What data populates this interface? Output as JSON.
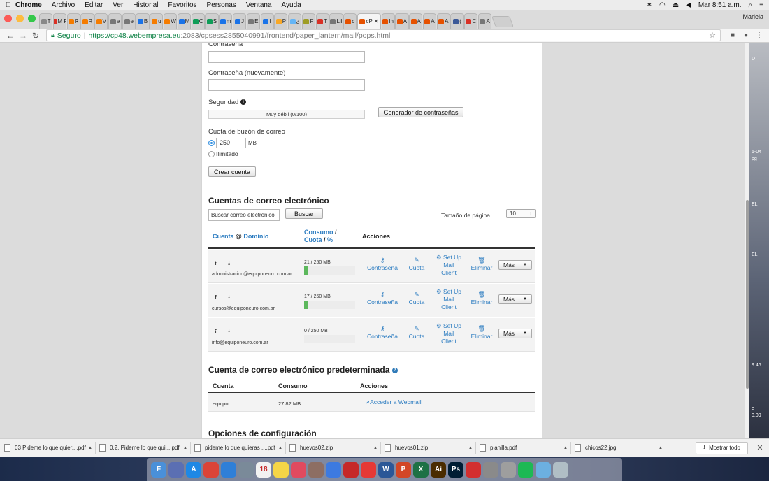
{
  "menubar": {
    "app": "Chrome",
    "items": [
      "Archivo",
      "Editar",
      "Ver",
      "Historial",
      "Favoritos",
      "Personas",
      "Ventana",
      "Ayuda"
    ],
    "clock": "Mar 8:51 a.m."
  },
  "tabs": [
    {
      "label": "T",
      "color": "#888"
    },
    {
      "label": "M R",
      "color": "#d93025"
    },
    {
      "label": "R",
      "color": "#f57c00"
    },
    {
      "label": "R",
      "color": "#f57c00"
    },
    {
      "label": "V",
      "color": "#f57c00"
    },
    {
      "label": "e",
      "color": "#777"
    },
    {
      "label": "e",
      "color": "#777"
    },
    {
      "label": "B",
      "color": "#1a73e8"
    },
    {
      "label": "u",
      "color": "#f57c00"
    },
    {
      "label": "W",
      "color": "#f57c00"
    },
    {
      "label": "M",
      "color": "#1a73e8"
    },
    {
      "label": "C",
      "color": "#0f9d58"
    },
    {
      "label": "S",
      "color": "#0f9d58"
    },
    {
      "label": "m",
      "color": "#1a73e8"
    },
    {
      "label": "J",
      "color": "#1a73e8"
    },
    {
      "label": "E",
      "color": "#777"
    },
    {
      "label": "I",
      "color": "#1a73e8"
    },
    {
      "label": "P",
      "color": "#f9a825"
    },
    {
      "label": "¿",
      "color": "#64b5f6"
    },
    {
      "label": "F",
      "color": "#9e9d24"
    },
    {
      "label": "T",
      "color": "#d93025"
    },
    {
      "label": "Lil",
      "color": "#777"
    },
    {
      "label": "c",
      "color": "#e65100"
    },
    {
      "label": "cP",
      "color": "#e65100",
      "active": true
    },
    {
      "label": "In",
      "color": "#e65100"
    },
    {
      "label": "A",
      "color": "#e65100"
    },
    {
      "label": "A",
      "color": "#e65100"
    },
    {
      "label": "A",
      "color": "#e65100"
    },
    {
      "label": "A",
      "color": "#e65100"
    },
    {
      "label": "(",
      "color": "#3b5998"
    },
    {
      "label": "C",
      "color": "#d93025"
    },
    {
      "label": "A",
      "color": "#777"
    }
  ],
  "profile": "Mariela",
  "address": {
    "secure_label": "Seguro",
    "host": "https://cp48.webempresa.eu",
    "path": ":2083/cpsess2855040991/frontend/paper_lantern/mail/pops.html"
  },
  "desktop": {
    "l1": "D",
    "l2": "5-04",
    "l3": "pg",
    "l4": "EL",
    "l5": "EL",
    "l6": "9.46",
    "l7": "e",
    "l8": "0.09"
  },
  "form": {
    "password_label": "Contraseña",
    "password_again_label": "Contraseña (nuevamente)",
    "security_label": "Seguridad",
    "strength_text": "Muy débil (0/100)",
    "generator_button": "Generador de contraseñas",
    "quota_label": "Cuota de buzón de correo",
    "quota_value": "250",
    "quota_unit": "MB",
    "unlimited_label": "Ilimitado",
    "create_button": "Crear cuenta"
  },
  "accounts": {
    "title": "Cuentas de correo electrónico",
    "search_placeholder": "Buscar correo electrónico",
    "search_button": "Buscar",
    "page_size_label": "Tamaño de página",
    "page_size_value": "10",
    "headers": {
      "account": "Cuenta",
      "at": "@",
      "domain": "Dominio",
      "usage": "Consumo",
      "slash": "/",
      "quota": "Cuota",
      "percent": "%",
      "actions": "Acciones"
    },
    "rows": [
      {
        "email": "administracion@equiponeuro.com.ar",
        "usage": "21 / 250 MB",
        "fraction": 0.084
      },
      {
        "email": "cursos@equiponeuro.com.ar",
        "usage": "17 / 250 MB",
        "fraction": 0.068
      },
      {
        "email": "info@equiponeuro.com.ar",
        "usage": "0 / 250 MB",
        "fraction": 0
      }
    ],
    "actions": {
      "password": "Contraseña",
      "quota": "Cuota",
      "setup_1": "Set Up",
      "setup_2": "Mail",
      "setup_3": "Client",
      "delete": "Eliminar",
      "more": "Más"
    }
  },
  "default_account": {
    "title": "Cuenta de correo electrónico predeterminada",
    "headers": {
      "account": "Cuenta",
      "usage": "Consumo",
      "actions": "Acciones"
    },
    "row": {
      "account": "equipo",
      "usage": "27.82 MB",
      "action": "Acceder a Webmail"
    }
  },
  "config": {
    "title": "Opciones de configuración"
  },
  "downloads": {
    "items": [
      "03 Pideme lo que quier....pdf",
      "0.2. Pideme lo que qui....pdf",
      "pideme lo que quieras ....pdf",
      "huevos02.zip",
      "huevos01.zip",
      "planilla.pdf",
      "chicos22.jpg"
    ],
    "show_all": "Mostrar todo"
  },
  "dock": {
    "apps": [
      {
        "label": "F",
        "color": "#4a90d9"
      },
      {
        "label": "",
        "color": "#5b6fb3"
      },
      {
        "label": "A",
        "color": "#1e88e5"
      },
      {
        "label": "",
        "color": "#db4437"
      },
      {
        "label": "",
        "color": "#2f7fd8"
      },
      {
        "label": "",
        "color": "#7a8a99"
      },
      {
        "label": "18",
        "color": "#f2f2f2"
      },
      {
        "label": "",
        "color": "#f5d547"
      },
      {
        "label": "",
        "color": "#e04a5f"
      },
      {
        "label": "",
        "color": "#8d6e63"
      },
      {
        "label": "",
        "color": "#3d7ae0"
      },
      {
        "label": "",
        "color": "#c62828"
      },
      {
        "label": "",
        "color": "#e53935"
      },
      {
        "label": "W",
        "color": "#2b5797"
      },
      {
        "label": "P",
        "color": "#d24726"
      },
      {
        "label": "X",
        "color": "#1e7145"
      },
      {
        "label": "Ai",
        "color": "#4a2c00"
      },
      {
        "label": "Ps",
        "color": "#001d34"
      },
      {
        "label": "",
        "color": "#d32f2f"
      },
      {
        "label": "",
        "color": "#8a8a8a"
      },
      {
        "label": "",
        "color": "#9e9e9e"
      },
      {
        "label": "",
        "color": "#1db954"
      },
      {
        "label": "",
        "color": "#6cb0e0"
      },
      {
        "label": "",
        "color": "#b0bec5"
      }
    ]
  }
}
